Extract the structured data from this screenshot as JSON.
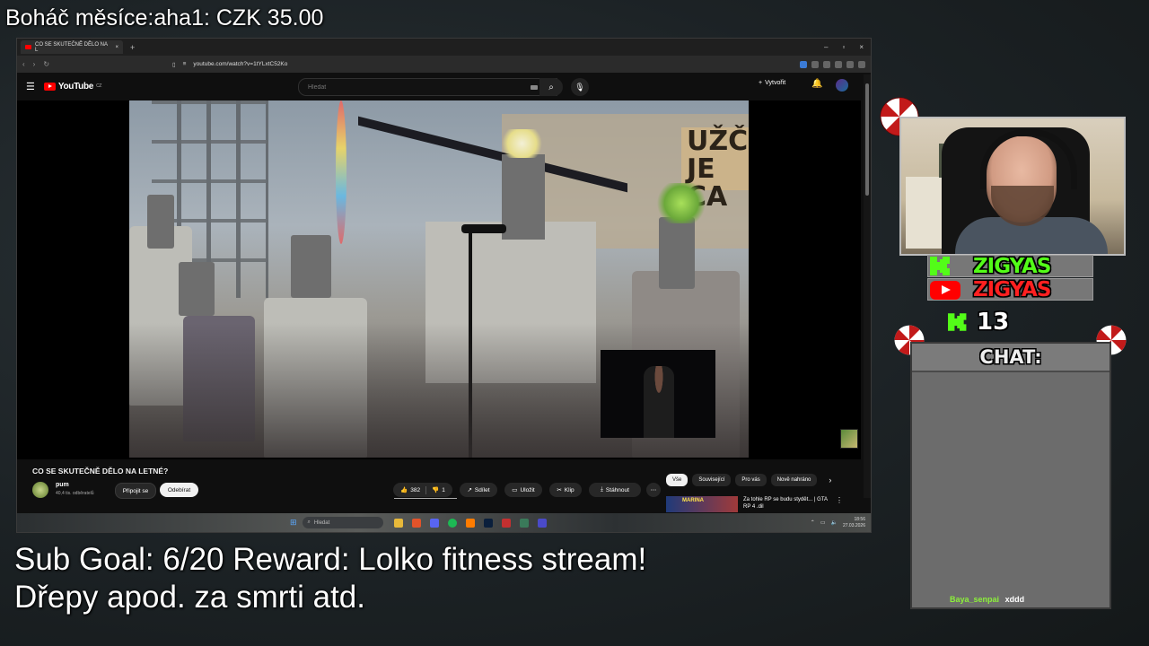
{
  "overlay": {
    "top_text": "Boháč měsíce:aha1: CZK 35.00",
    "goal_line1": "Sub Goal: 6/20 Reward: Lolko fitness stream!",
    "goal_line2": "Dřepy apod. za smrti atd."
  },
  "browser": {
    "tab_title": "CO SE SKUTEČNĚ DĚLO NA L",
    "tab_close": "×",
    "new_tab": "+",
    "window_controls": [
      "–",
      "▫",
      "×"
    ],
    "url": "youtube.com/watch?v=1tYLxtC52Ko"
  },
  "youtube": {
    "logo_text": "YouTube",
    "logo_region": "CZ",
    "search_placeholder": "Hledat",
    "create_label": "Vytvořit",
    "video_title": "CO SE SKUTEČNĚ DĚLO NA LETNÉ?",
    "channel_name": "pum",
    "channel_subs": "40,4 tis. odběratelů",
    "join_label": "Připojit se",
    "unsubscribe_label": "Odebírat",
    "likes": "382",
    "dislikes": "1",
    "share_label": "Sdílet",
    "save_label": "Uložit",
    "clip_label": "Klip",
    "download_label": "Stáhnout",
    "chips": [
      "Vše",
      "Související",
      "Pro vás",
      "Nově nahráno"
    ],
    "rec_thumb_text": "MARINA",
    "rec_title": "Za tohle RP se budu stydět... | GTA RP 4 .dil"
  },
  "video": {
    "sign_text": "UŽČ JE CA"
  },
  "taskbar": {
    "search_placeholder": "Hledat",
    "time": "18:56",
    "date": "27.03.2026"
  },
  "streamer": {
    "kick_name": "ZIGYAS",
    "youtube_name": "ZIGYAS",
    "viewer_count": "13",
    "chat_title": "CHAT:",
    "chat_messages": [
      {
        "user": "Baya_senpai",
        "text": "xddd"
      }
    ]
  },
  "colors": {
    "kick_green": "#53fc18",
    "youtube_red": "#ff0000",
    "chat_user": "#8cf03a"
  }
}
